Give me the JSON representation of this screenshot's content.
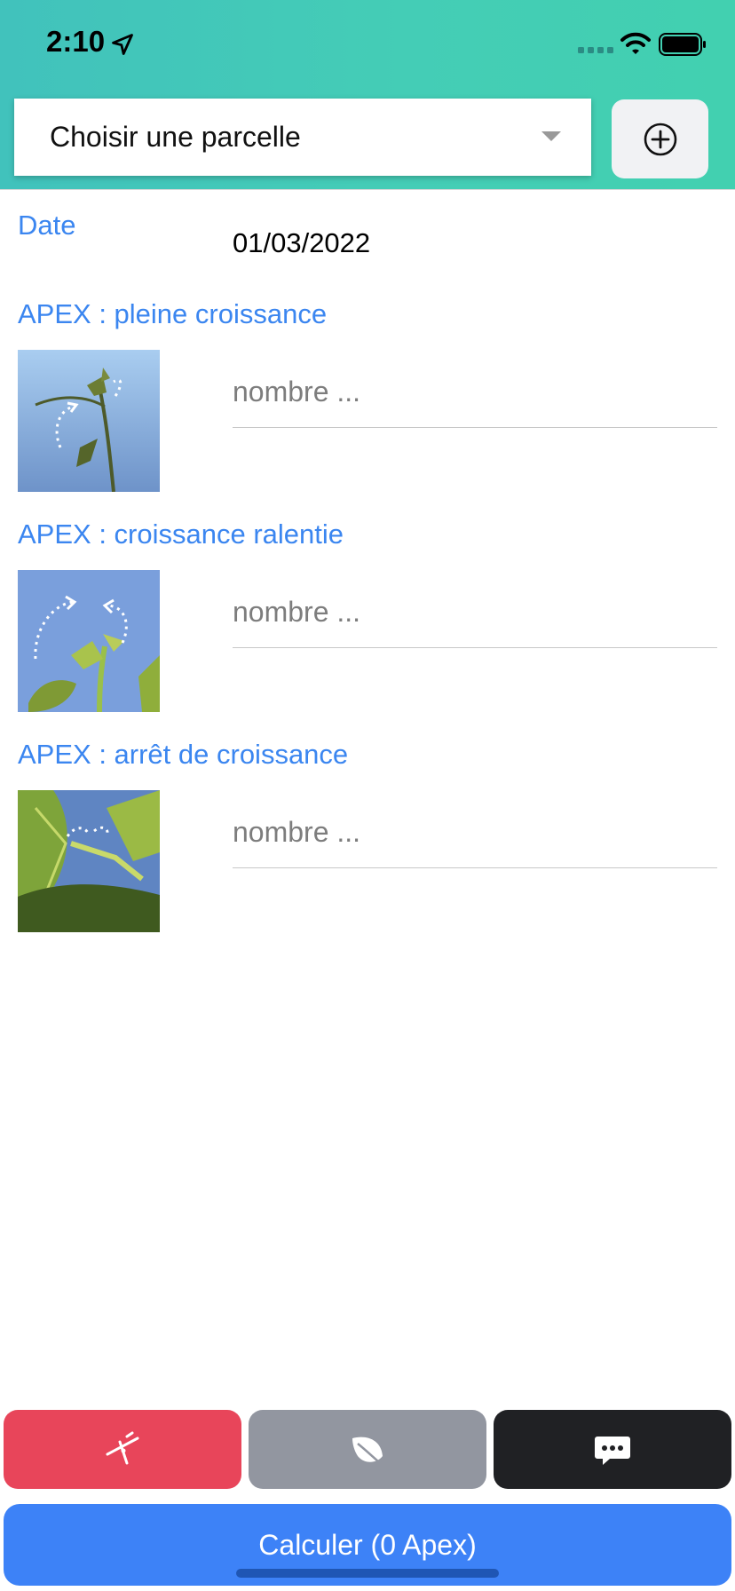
{
  "status_bar": {
    "time": "2:10",
    "icons": [
      "location-arrow-icon",
      "cellular-signal-icon",
      "wifi-icon",
      "battery-icon"
    ]
  },
  "header": {
    "select_placeholder": "Choisir une parcelle",
    "add_icon": "plus-circle-icon"
  },
  "form": {
    "date_label": "Date",
    "date_value": "01/03/2022",
    "apex_items": [
      {
        "label": "APEX : pleine croissance",
        "placeholder": "nombre ..."
      },
      {
        "label": "APEX : croissance ralentie",
        "placeholder": "nombre ..."
      },
      {
        "label": "APEX : arrêt de croissance",
        "placeholder": "nombre ..."
      }
    ]
  },
  "bottom_bar": {
    "buttons": [
      {
        "icon": "pruning-shears-icon",
        "color": "#e8455a"
      },
      {
        "icon": "leaf-icon",
        "color": "#9296a0"
      },
      {
        "icon": "chat-bubble-icon",
        "color": "#202124"
      }
    ],
    "calculate_label": "Calculer (0 Apex)",
    "calculate_color": "#3d82f7"
  },
  "colors": {
    "header_gradient_start": "#41c2bc",
    "header_gradient_end": "#42d0b0",
    "label_blue": "#3b86f0"
  }
}
